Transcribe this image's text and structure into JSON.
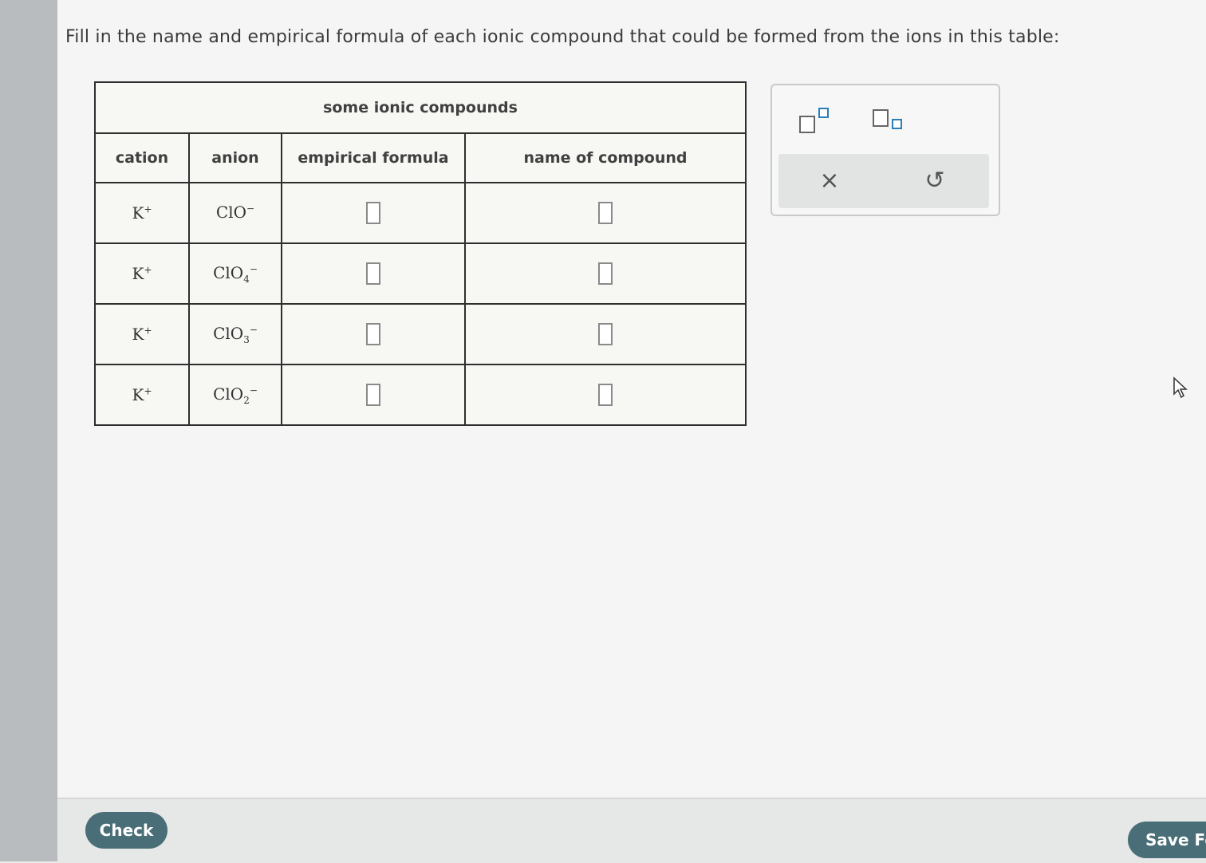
{
  "prompt": "Fill in the name and empirical formula of each ionic compound that could be formed from the ions in this table:",
  "table": {
    "group_header": "some ionic compounds",
    "columns": [
      "cation",
      "anion",
      "empirical formula",
      "name of compound"
    ],
    "rows": [
      {
        "cation": "K",
        "cation_charge": "+",
        "anion": "ClO",
        "anion_sub": "",
        "anion_charge": "−",
        "empirical_formula": "",
        "name": ""
      },
      {
        "cation": "K",
        "cation_charge": "+",
        "anion": "ClO",
        "anion_sub": "4",
        "anion_charge": "−",
        "empirical_formula": "",
        "name": ""
      },
      {
        "cation": "K",
        "cation_charge": "+",
        "anion": "ClO",
        "anion_sub": "3",
        "anion_charge": "−",
        "empirical_formula": "",
        "name": ""
      },
      {
        "cation": "K",
        "cation_charge": "+",
        "anion": "ClO",
        "anion_sub": "2",
        "anion_charge": "−",
        "empirical_formula": "",
        "name": ""
      }
    ]
  },
  "palette": {
    "tools": [
      "superscript-icon",
      "subscript-icon"
    ],
    "clear_label": "×",
    "undo_label": "↺"
  },
  "footer": {
    "check_label": "Check",
    "save_label": "Save Fo"
  },
  "colors": {
    "button_bg": "#4a6e77",
    "accent_box": "#2b7fb5"
  }
}
